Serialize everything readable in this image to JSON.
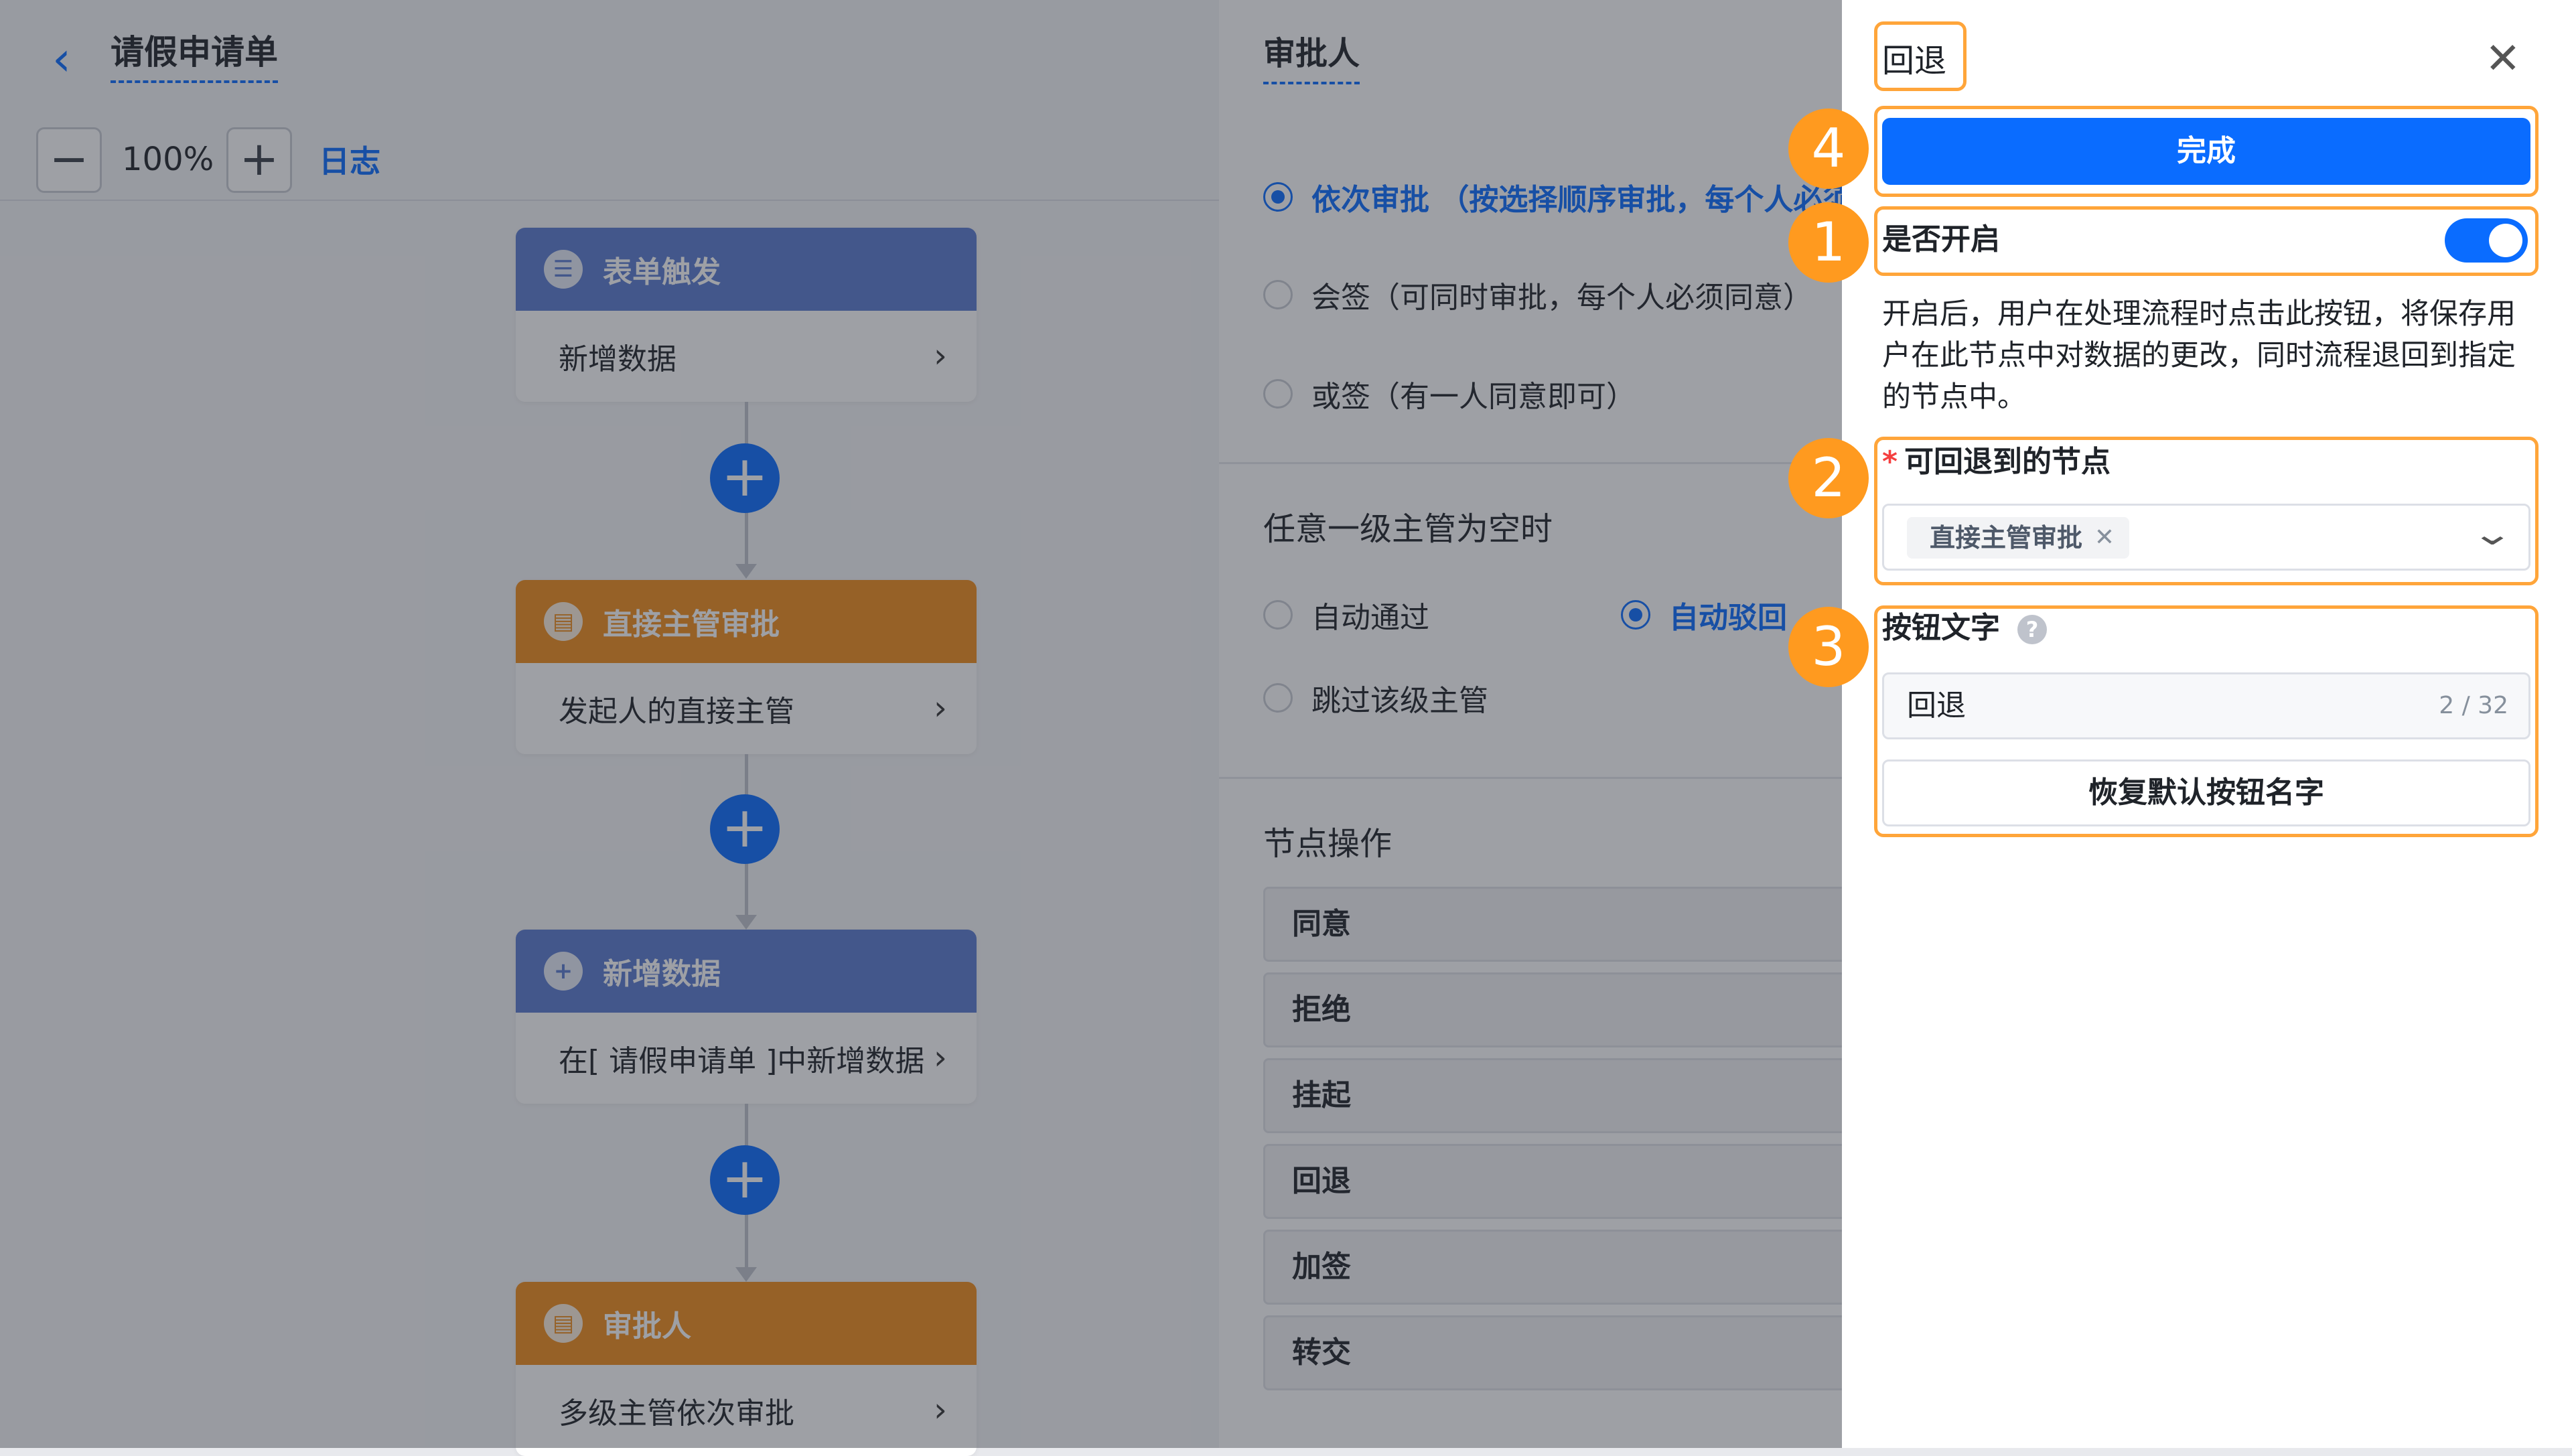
{
  "flow": {
    "title": "请假申请单",
    "zoom": "100%",
    "log_label": "日志",
    "nodes": [
      {
        "header": "表单触发",
        "body": "新增数据"
      },
      {
        "header": "直接主管审批",
        "body": "发起人的直接主管"
      },
      {
        "header": "新增数据",
        "body": "在[ 请假申请单 ]中新增数据"
      },
      {
        "header": "审批人",
        "body": "多级主管依次审批"
      }
    ]
  },
  "approver": {
    "title": "审批人",
    "modes": [
      "依次审批 （按选择顺序审批，每个人必须同意）",
      "会签（可同时审批，每个人必须同意）",
      "或签（有一人同意即可）"
    ],
    "empty_section_title": "任意一级主管为空时",
    "empty_options": [
      "自动通过",
      "自动驳回",
      "跳过该级主管"
    ],
    "ops_title": "节点操作",
    "ops": [
      "同意",
      "拒绝",
      "挂起",
      "回退",
      "加签",
      "转交"
    ]
  },
  "drawer": {
    "title": "回退",
    "done_label": "完成",
    "enable_label": "是否开启",
    "enabled": true,
    "description": "开启后，用户在处理流程时点击此按钮，将保存用户在此节点中对数据的更改，同时流程退回到指定的节点中。",
    "required_mark": "*",
    "rollback_label": "可回退到的节点",
    "rollback_selected": "直接主管审批",
    "button_text_label": "按钮文字",
    "button_text_value": "回退",
    "button_text_counter": "2 / 32",
    "reset_label": "恢复默认按钮名字"
  },
  "badges": [
    "4",
    "1",
    "2",
    "3"
  ],
  "colors": {
    "accent": "#0a6cff",
    "highlight": "#ffa53a",
    "badge": "#ff9a1f",
    "node_blue": "#5a7bcf",
    "node_orange": "#f08c1b"
  }
}
